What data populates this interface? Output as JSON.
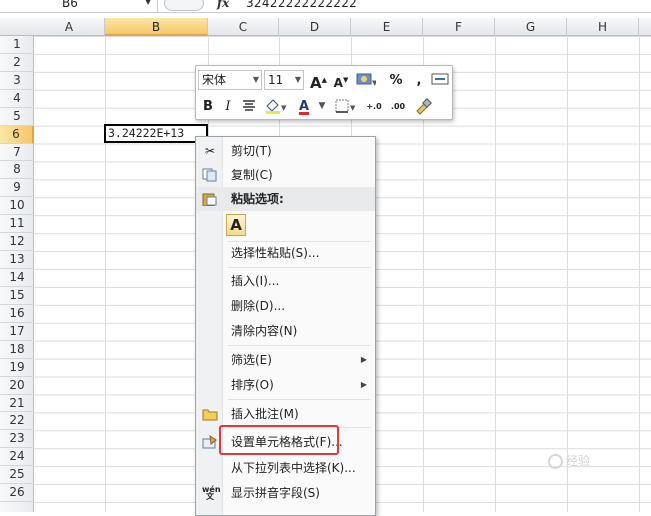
{
  "formula_bar": {
    "name_box": "B6",
    "fx": "fx",
    "content": "32422222222222"
  },
  "columns": [
    "A",
    "B",
    "C",
    "D",
    "E",
    "F",
    "G",
    "H"
  ],
  "rows": [
    "1",
    "2",
    "3",
    "4",
    "5",
    "6",
    "7",
    "8",
    "9",
    "10",
    "11",
    "12",
    "13",
    "14",
    "15",
    "16",
    "17",
    "18",
    "19",
    "20",
    "21",
    "22",
    "23",
    "24",
    "25",
    "26"
  ],
  "selected_cell": {
    "ref": "B6",
    "display": "3.24222E+13"
  },
  "mini_toolbar": {
    "font_name": "宋体",
    "font_size": "11",
    "grow_font": "A",
    "shrink_font": "A",
    "percent": "%",
    "comma": ",",
    "bold": "B",
    "italic": "I",
    "font_color": "A",
    "inc_decimal": "+.0",
    "dec_decimal": ".00"
  },
  "context_menu": {
    "items": [
      {
        "label": "剪切(T)",
        "icon": "scissors-icon"
      },
      {
        "label": "复制(C)",
        "icon": "copy-icon"
      },
      {
        "label": "粘贴选项:",
        "icon": "paste-icon"
      },
      {
        "label": "选择性粘贴(S)..."
      },
      {
        "label": "插入(I)..."
      },
      {
        "label": "删除(D)..."
      },
      {
        "label": "清除内容(N)"
      },
      {
        "label": "筛选(E)",
        "submenu": true
      },
      {
        "label": "排序(O)",
        "submenu": true
      },
      {
        "label": "插入批注(M)",
        "icon": "comment-icon"
      },
      {
        "label": "设置单元格格式(F)...",
        "icon": "format-cells-icon"
      },
      {
        "label": "从下拉列表中选择(K)..."
      },
      {
        "label": "显示拼音字段(S)",
        "icon": "phonetic-icon"
      }
    ],
    "paste_button": "A",
    "submenu_arrow": "▶"
  },
  "watermark": "经验",
  "colors": {
    "highlight_box": "#e0393b",
    "selected_header": "#f5c76a"
  }
}
